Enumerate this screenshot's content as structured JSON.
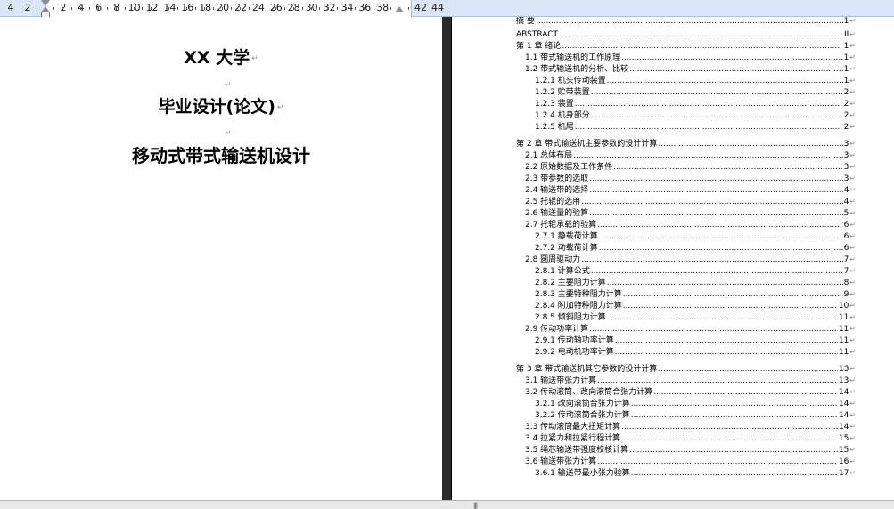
{
  "ruler": {
    "left_numbers": [
      "4",
      "2"
    ],
    "numbers": [
      "2",
      "4",
      "6",
      "8",
      "10",
      "12",
      "14",
      "16",
      "18",
      "20",
      "22",
      "24",
      "26",
      "28",
      "30",
      "32",
      "34",
      "36",
      "38"
    ],
    "right_numbers": [
      "42",
      "44"
    ]
  },
  "title_page": {
    "school": "XX 大学",
    "thesis_type": "毕业设计(论文)",
    "thesis_title": "移动式带式输送机设计",
    "para_mark": "↵"
  },
  "toc": [
    {
      "title": "摘    要",
      "page": "1",
      "level": 0
    },
    {
      "title": "ABSTRACT",
      "page": "II",
      "level": 0
    },
    {
      "title": "第 1 章  绪论",
      "page": "1",
      "level": 0
    },
    {
      "title": "1.1 带式输送机的工作原理",
      "page": "1",
      "level": 1
    },
    {
      "title": "1.2 带式输送机的分析、比较",
      "page": "1",
      "level": 1
    },
    {
      "title": "1.2.1 机头传动装置",
      "page": "1",
      "level": 2
    },
    {
      "title": "1.2.2 贮带装置",
      "page": "2",
      "level": 2
    },
    {
      "title": "1.2.3 装置",
      "page": "2",
      "level": 2
    },
    {
      "title": "1.2.4 机身部分",
      "page": "2",
      "level": 2
    },
    {
      "title": "1.2.5 机尾",
      "page": "2",
      "level": 2
    },
    {
      "title": "第 2 章   带式输送机主要参数的设计计算",
      "page": "3",
      "level": 0
    },
    {
      "title": "2.1   总体布局",
      "page": "3",
      "level": 1
    },
    {
      "title": "2.2   原始数据及工作条件",
      "page": "3",
      "level": 1
    },
    {
      "title": "2.3   带参数的选取",
      "page": "3",
      "level": 1
    },
    {
      "title": "2.4   输送带的选择",
      "page": "4",
      "level": 1
    },
    {
      "title": "2.5   托辊的选用",
      "page": "4",
      "level": 1
    },
    {
      "title": "2.6   输送量的验算",
      "page": "5",
      "level": 1
    },
    {
      "title": "2.7   托辊承载的验算",
      "page": "6",
      "level": 1
    },
    {
      "title": "2.7.1    静载荷计算",
      "page": "6",
      "level": 2
    },
    {
      "title": "2.7.2    动载荷计算",
      "page": "6",
      "level": 2
    },
    {
      "title": "2.8 圆周驱动力",
      "page": "7",
      "level": 1
    },
    {
      "title": "2.8.1  计算公式",
      "page": "7",
      "level": 2
    },
    {
      "title": "2.8.2  主要阻力计算",
      "page": "8",
      "level": 2
    },
    {
      "title": "2.8.3  主要特种阻力计算",
      "page": "9",
      "level": 2
    },
    {
      "title": "2.8.4  附加特种阻力计算",
      "page": "10",
      "level": 2
    },
    {
      "title": "2.8.5  倾斜阻力计算",
      "page": "11",
      "level": 2
    },
    {
      "title": "2.9 传动功率计算",
      "page": "11",
      "level": 1
    },
    {
      "title": "2.9.1  传动轴功率计算",
      "page": "11",
      "level": 2
    },
    {
      "title": "2.9.2  电动机功率计算",
      "page": "11",
      "level": 2
    },
    {
      "title": "第 3 章    带式输送机其它参数的设计计算",
      "page": "13",
      "level": 0
    },
    {
      "title": "3.1 输送带张力计算",
      "page": "13",
      "level": 1
    },
    {
      "title": "3.2 传动滚筒、改向滚筒合张力计算",
      "page": "14",
      "level": 1
    },
    {
      "title": "3.2.1  改向滚筒合张力计算",
      "page": "14",
      "level": 2
    },
    {
      "title": "3.2.2  传动滚筒合张力计算",
      "page": "14",
      "level": 2
    },
    {
      "title": "3.3 传动滚筒最大扭矩计算",
      "page": "14",
      "level": 1
    },
    {
      "title": "3.4 拉紧力和拉紧行程计算",
      "page": "15",
      "level": 1
    },
    {
      "title": "3.5 绳芯输送带强度校核计算",
      "page": "15",
      "level": 1
    },
    {
      "title": "3.6   输送带张力计算",
      "page": "16",
      "level": 1
    },
    {
      "title": "3.6.1    输送带最小张力验算",
      "page": "17",
      "level": 2
    }
  ],
  "statusbar": {
    "grip": "|||"
  }
}
